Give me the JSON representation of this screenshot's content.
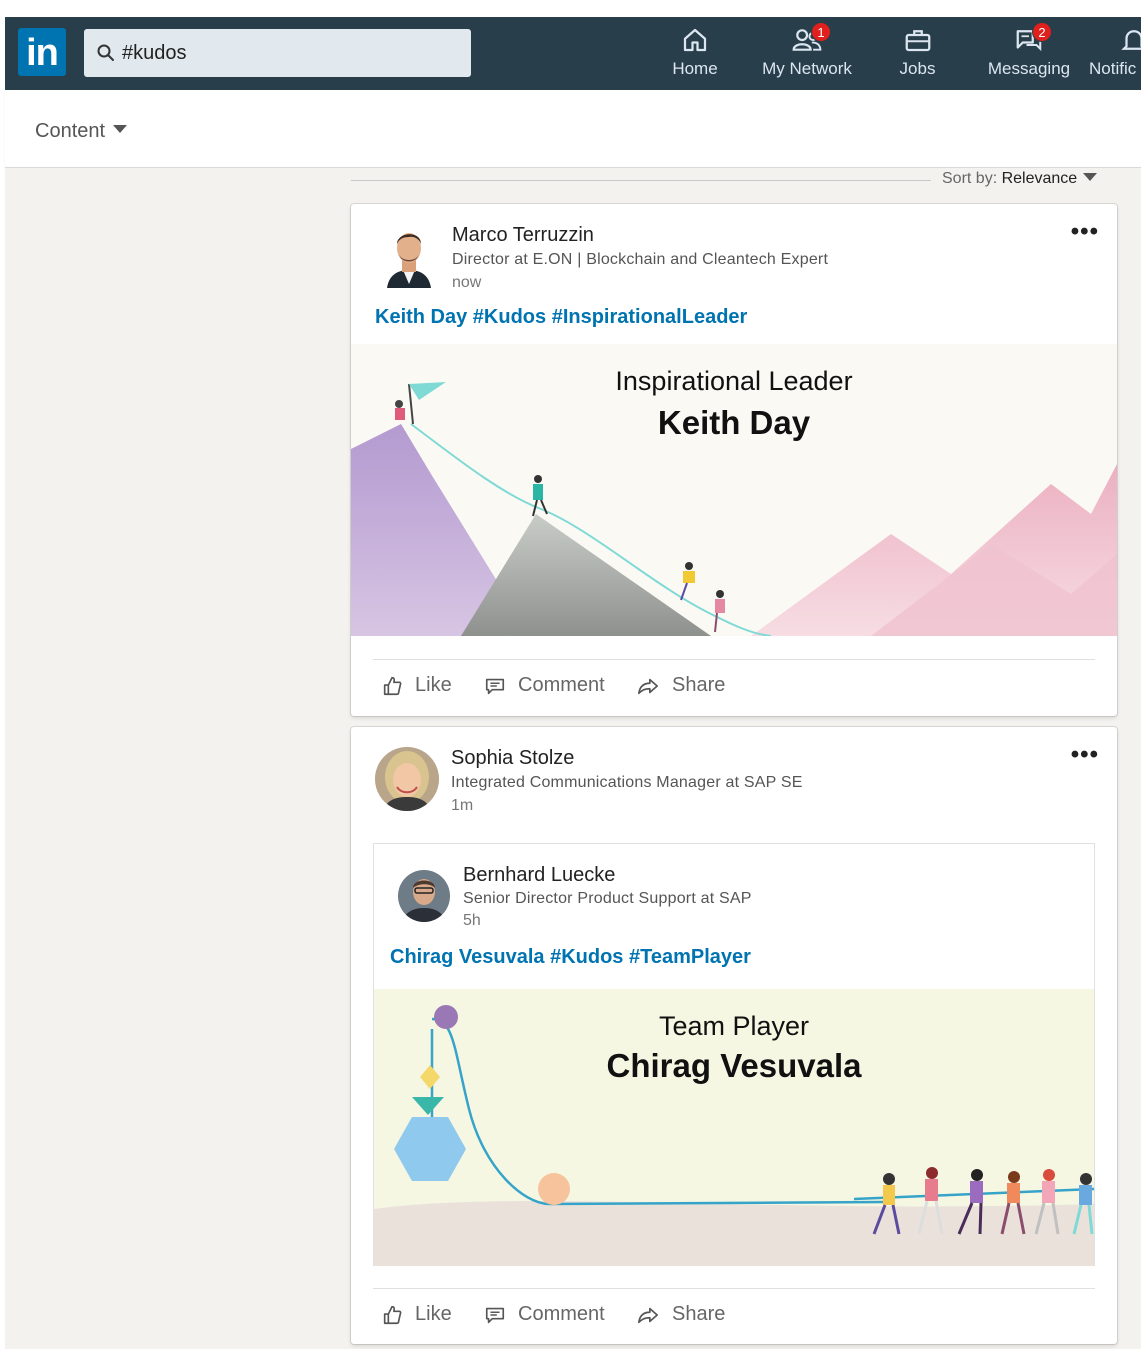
{
  "nav": {
    "search_value": "#kudos",
    "items": [
      {
        "label": "Home",
        "icon": "home-icon"
      },
      {
        "label": "My Network",
        "icon": "network-icon",
        "badge": "1"
      },
      {
        "label": "Jobs",
        "icon": "briefcase-icon"
      },
      {
        "label": "Messaging",
        "icon": "messaging-icon",
        "badge": "2"
      },
      {
        "label": "Notific",
        "icon": "bell-icon"
      }
    ],
    "brand_color": "#283e4a",
    "accent_color": "#0073b1",
    "badge_color": "#e0201c"
  },
  "filter": {
    "label": "Content"
  },
  "sort": {
    "prefix": "Sort by:",
    "value": "Relevance"
  },
  "posts": [
    {
      "author": "Marco Terruzzin",
      "headline": "Director at E.ON | Blockchain and Cleantech Expert",
      "time": "now",
      "text": "Keith Day #Kudos #InspirationalLeader",
      "image": {
        "line1": "Inspirational Leader",
        "line2": "Keith Day"
      },
      "more": "•••",
      "actions": {
        "like": "Like",
        "comment": "Comment",
        "share": "Share"
      }
    },
    {
      "author": "Sophia Stolze",
      "headline": "Integrated Communications Manager at SAP SE",
      "time": "1m",
      "more": "•••",
      "shared": {
        "author": "Bernhard Luecke",
        "headline": "Senior Director Product Support at SAP",
        "time": "5h",
        "text": "Chirag Vesuvala #Kudos #TeamPlayer",
        "image": {
          "line1": "Team Player",
          "line2": "Chirag Vesuvala"
        }
      },
      "actions": {
        "like": "Like",
        "comment": "Comment",
        "share": "Share"
      }
    }
  ]
}
